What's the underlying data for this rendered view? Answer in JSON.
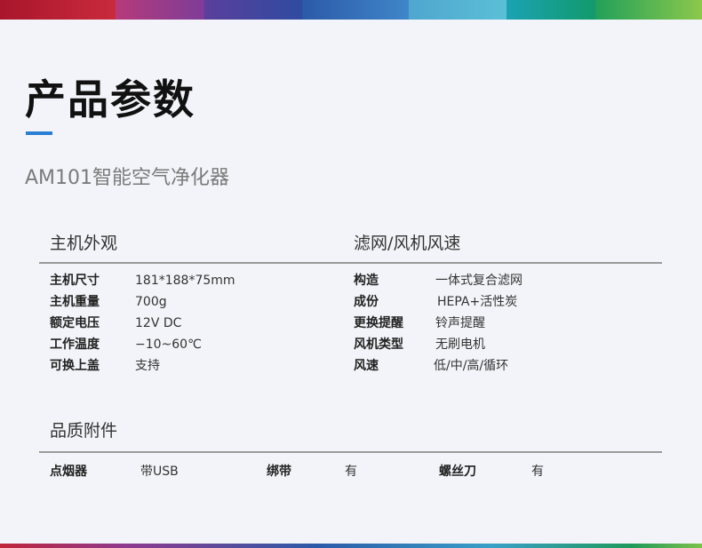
{
  "colors": {
    "accent": "#2a7fd4",
    "band": [
      "#c0243a",
      "#8e3a8f",
      "#3b3f9a",
      "#2c5aa8",
      "#39a0c8",
      "#22a0a8",
      "#1f9a5b"
    ]
  },
  "title": "产品参数",
  "subtitle": "AM101智能空气净化器",
  "appearance": {
    "heading": "主机外观",
    "rows": [
      {
        "label": "主机尺寸",
        "value": "181*188*75mm"
      },
      {
        "label": "主机重量",
        "value": "700g"
      },
      {
        "label": "额定电压",
        "value": "12V DC"
      },
      {
        "label": "工作温度",
        "value": "−10~60℃"
      },
      {
        "label": "可换上盖",
        "value": "支持"
      }
    ]
  },
  "filter": {
    "heading": "滤网/风机风速",
    "rows": [
      {
        "label": "构造",
        "value": "一体式复合滤网"
      },
      {
        "label": "成份",
        "value": "HEPA+活性炭"
      },
      {
        "label": "更换提醒",
        "value": "铃声提醒"
      },
      {
        "label": "风机类型",
        "value": "无刷电机"
      },
      {
        "label": "风速",
        "value": "低/中/高/循环"
      }
    ]
  },
  "accessories": {
    "heading": "品质附件",
    "items": [
      {
        "label": "点烟器",
        "value": "带USB"
      },
      {
        "label": "绑带",
        "value": "有"
      },
      {
        "label": "螺丝刀",
        "value": "有"
      }
    ]
  }
}
